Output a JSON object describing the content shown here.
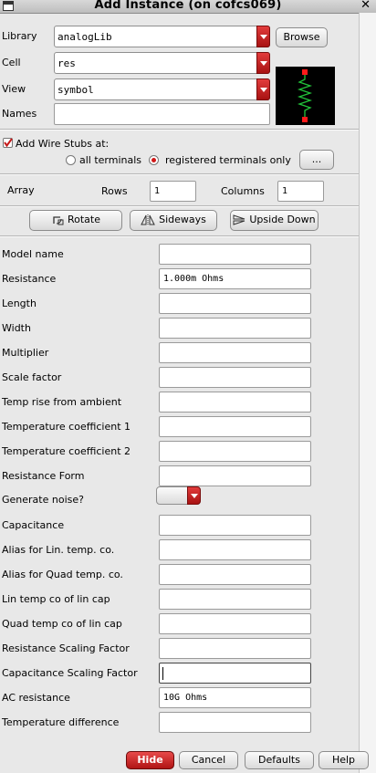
{
  "window": {
    "title": "Add Instance (on cofcs069)",
    "close_glyph": "✕"
  },
  "library": {
    "label": "Library",
    "value": "analogLib",
    "browse_label": "Browse"
  },
  "cell": {
    "label": "Cell",
    "value": "res"
  },
  "view": {
    "label": "View",
    "value": "symbol"
  },
  "names": {
    "label": "Names",
    "value": ""
  },
  "wire_stubs": {
    "label": "Add Wire Stubs at:",
    "checked": true,
    "option_all": "all terminals",
    "option_registered": "registered terminals only",
    "selected": "registered terminals only",
    "more_label": "..."
  },
  "array": {
    "label": "Array",
    "rows_label": "Rows",
    "rows_value": "1",
    "columns_label": "Columns",
    "columns_value": "1"
  },
  "transform": {
    "rotate": "Rotate",
    "sideways": "Sideways",
    "upside_down": "Upside Down"
  },
  "params": [
    {
      "label": "Model name",
      "value": ""
    },
    {
      "label": "Resistance",
      "value": "1.000m Ohms"
    },
    {
      "label": "Length",
      "value": ""
    },
    {
      "label": "Width",
      "value": ""
    },
    {
      "label": "Multiplier",
      "value": ""
    },
    {
      "label": "Scale factor",
      "value": ""
    },
    {
      "label": "Temp rise from ambient",
      "value": ""
    },
    {
      "label": "Temperature coefficient 1",
      "value": ""
    },
    {
      "label": "Temperature coefficient 2",
      "value": ""
    },
    {
      "label": "Resistance Form",
      "value": ""
    },
    {
      "label": "Generate noise?",
      "value": ""
    },
    {
      "label": "Capacitance",
      "value": ""
    },
    {
      "label": "Alias for Lin. temp. co.",
      "value": ""
    },
    {
      "label": "Alias for Quad temp. co.",
      "value": ""
    },
    {
      "label": "Lin temp co of lin cap",
      "value": ""
    },
    {
      "label": "Quad temp co of lin cap",
      "value": ""
    },
    {
      "label": "Resistance Scaling Factor",
      "value": ""
    },
    {
      "label": "Capacitance Scaling Factor",
      "value": ""
    },
    {
      "label": "AC resistance",
      "value": "10G Ohms"
    },
    {
      "label": "Temperature difference",
      "value": ""
    }
  ],
  "footer": {
    "hide": "Hide",
    "cancel": "Cancel",
    "defaults": "Defaults",
    "help": "Help"
  },
  "icons": {
    "rotate": "rotate-icon",
    "sideways": "sideways-icon",
    "upside_down": "upside-down-icon",
    "dropdown": "chevron-down-icon"
  },
  "colors": {
    "accent_red": "#c41a1a",
    "preview_bg": "#000000",
    "symbol_green": "#22c43a",
    "symbol_red": "#ff1a1a"
  }
}
